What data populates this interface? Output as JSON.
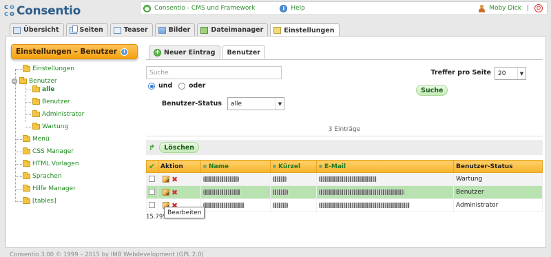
{
  "logo": {
    "letters": [
      "c",
      "o",
      "c",
      "o"
    ],
    "text": "Consentio"
  },
  "topbar": {
    "home_link": "Consentio - CMS und Framework",
    "help_label": "Help",
    "user_name": "Moby Dick",
    "separator": "|"
  },
  "tabs": [
    {
      "label": "Übersicht",
      "icon": "overview-icon"
    },
    {
      "label": "Seiten",
      "icon": "pages-icon"
    },
    {
      "label": "Teaser",
      "icon": "teaser-icon"
    },
    {
      "label": "Bilder",
      "icon": "images-icon"
    },
    {
      "label": "Dateimanager",
      "icon": "filemanager-icon"
    },
    {
      "label": "Einstellungen",
      "icon": "settings-icon",
      "active": true
    }
  ],
  "sidebar": {
    "title": "Einstellungen – Benutzer",
    "tree": [
      {
        "label": "Einstellungen"
      },
      {
        "label": "Benutzer"
      },
      {
        "label": "alle",
        "selected": true
      },
      {
        "label": "Benutzer"
      },
      {
        "label": "Administrator"
      },
      {
        "label": "Wartung"
      },
      {
        "label": "Menü"
      },
      {
        "label": "CSS Manager"
      },
      {
        "label": "HTML Vorlagen"
      },
      {
        "label": "Sprachen"
      },
      {
        "label": "Hilfe Manager"
      },
      {
        "label": "[tables]"
      }
    ]
  },
  "subtabs": {
    "new_entry": "Neuer Eintrag",
    "users": "Benutzer"
  },
  "search": {
    "placeholder": "Suche",
    "radio_and": "und",
    "radio_or": "oder",
    "hits_label": "Treffer pro Seite",
    "hits_value": "20",
    "search_button": "Suche",
    "status_label": "Benutzer-Status",
    "status_value": "alle"
  },
  "results": {
    "count_text": "3 Einträge",
    "delete_button": "Löschen"
  },
  "table": {
    "headers": {
      "action": "Aktion",
      "name": "Name",
      "short": "Kürzel",
      "email": "E-Mail",
      "status": "Benutzer-Status"
    },
    "rows": [
      {
        "status": "Wartung"
      },
      {
        "status": "Benutzer"
      },
      {
        "status": "Administrator"
      }
    ]
  },
  "footer_number": "15.795",
  "tooltip": "Bearbeiten",
  "copyright": "Consentio 3.00 © 1999 – 2015 by IMB Webdevelopment (GPL 2.0)",
  "colors": {
    "accent_orange": "#f4a20f",
    "link_green": "#1d8a1d",
    "highlight_row": "#b8e3b0"
  }
}
